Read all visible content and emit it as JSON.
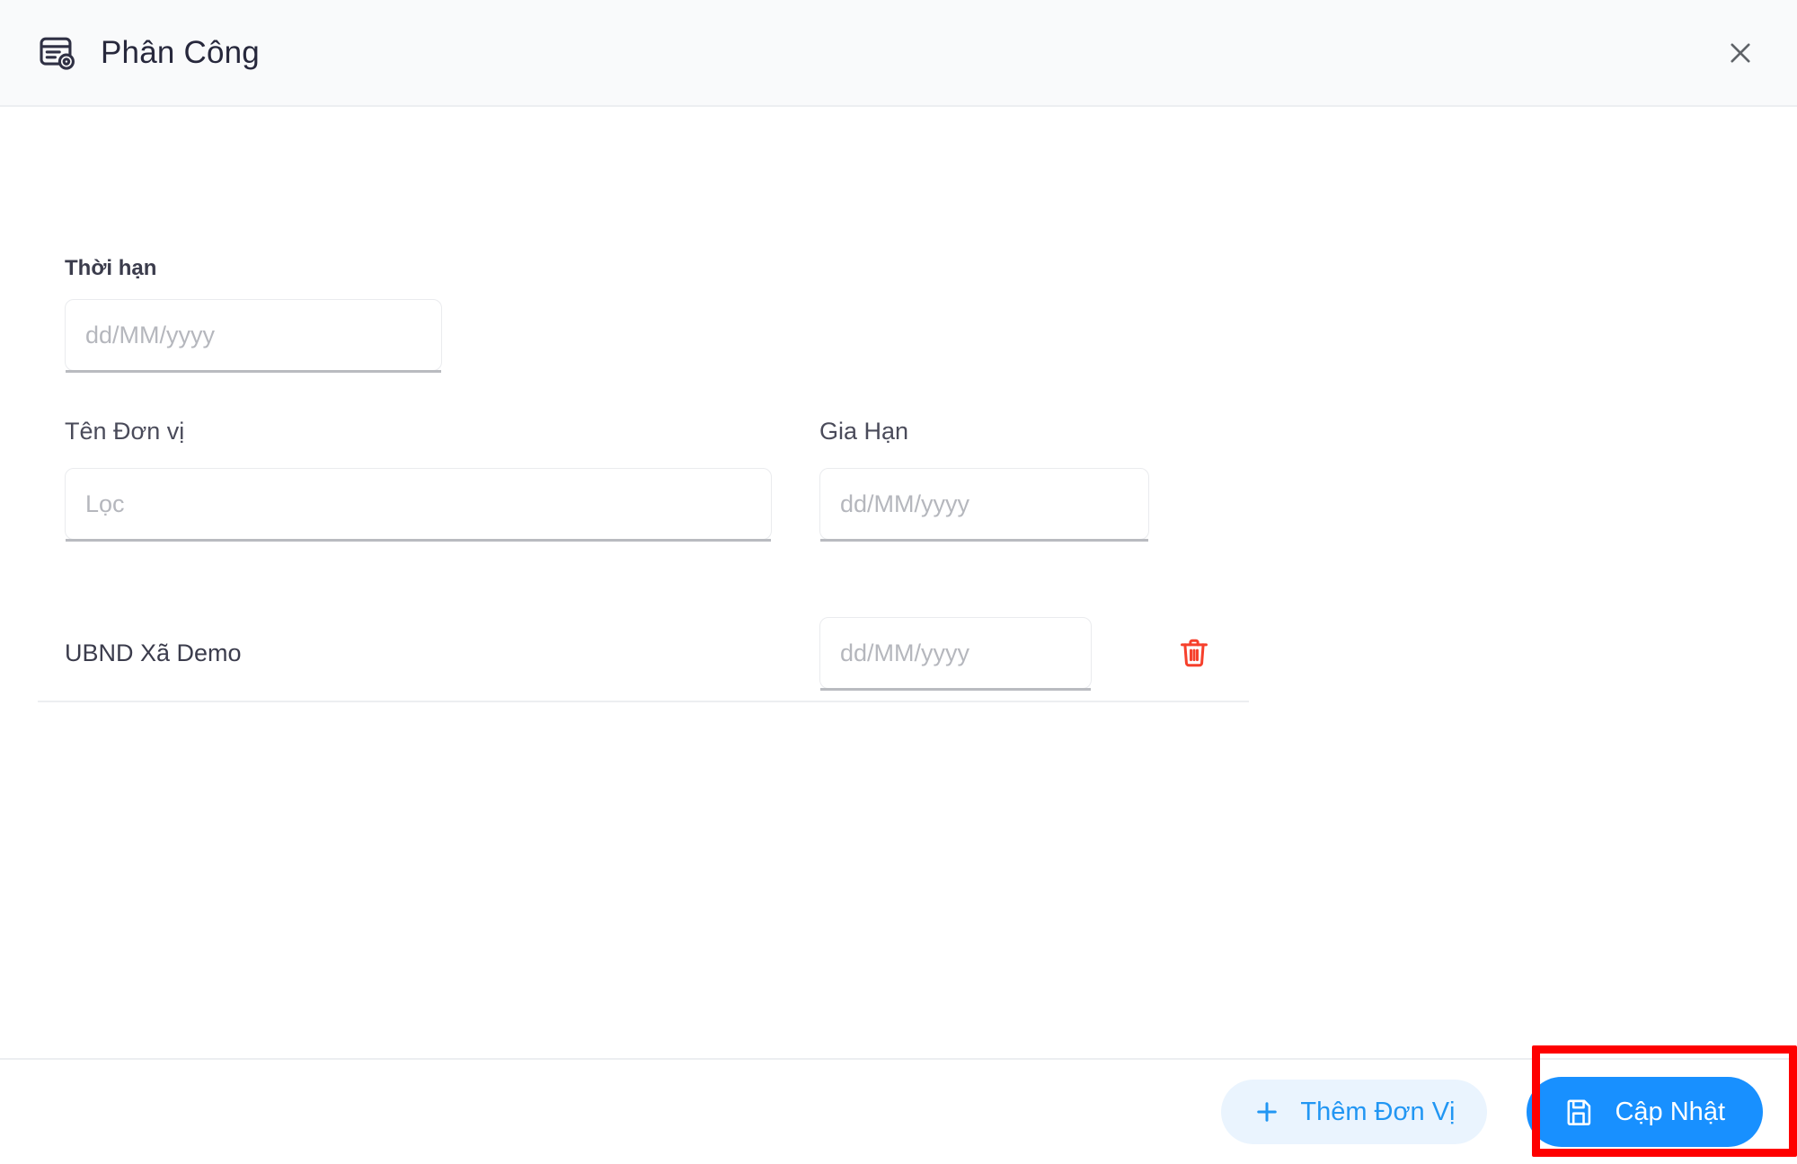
{
  "dialog": {
    "title": "Phân Công",
    "title_icon": "assignment-card-gear-icon",
    "close_icon": "close-icon"
  },
  "form": {
    "deadline": {
      "label": "Thời hạn",
      "placeholder": "dd/MM/yyyy",
      "value": ""
    },
    "unit_name": {
      "label": "Tên Đơn vị",
      "placeholder": "Lọc",
      "value": ""
    },
    "extension": {
      "label": "Gia Hạn",
      "placeholder": "dd/MM/yyyy",
      "value": ""
    }
  },
  "rows": [
    {
      "name": "UBND Xã Demo",
      "date_placeholder": "dd/MM/yyyy",
      "date_value": "",
      "delete_icon": "trash-icon"
    }
  ],
  "footer": {
    "add_unit_label": "Thêm Đơn Vị",
    "add_unit_icon": "plus-icon",
    "update_label": "Cập Nhật",
    "update_icon": "save-icon"
  },
  "colors": {
    "primary": "#1890ff",
    "secondary_bg": "#eaf4fe",
    "secondary_text": "#2196f3",
    "danger": "#f6402c",
    "highlight": "#fe0000",
    "header_bg": "#f9fafb",
    "divider": "#eceef1",
    "text": "#3b3c4c",
    "placeholder": "#b5b7bd"
  }
}
